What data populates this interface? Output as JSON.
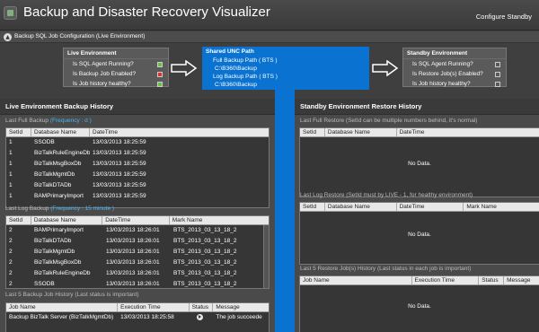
{
  "header": {
    "title": "Backup and Disaster Recovery Visualizer",
    "configure": "Configure Standby"
  },
  "subheader": {
    "label": "Backup SQL Job Configuration (Live Environment)"
  },
  "live_env": {
    "title": "Live Environment",
    "rows": [
      {
        "label": "Is SQL Agent Running?",
        "status": "ok"
      },
      {
        "label": "Is Backup Job Enabled?",
        "status": "bad"
      },
      {
        "label": "Is Job history healthy?",
        "status": "ok"
      }
    ]
  },
  "unc": {
    "title": "Shared UNC Path",
    "full_label": "Full Backup Path ( BTS )",
    "full_path": "C:\\B360\\Backup",
    "log_label": "Log Backup Path ( BTS )",
    "log_path": "C:\\B360\\Backup"
  },
  "standby_env": {
    "title": "Standby Environment",
    "rows": [
      {
        "label": "Is SQL Agent Running?",
        "status": "off"
      },
      {
        "label": "Is Restore Job(s) Enabled?",
        "status": "off"
      },
      {
        "label": "Is Job history healthy?",
        "status": "off"
      }
    ]
  },
  "live_history": {
    "title": "Live Environment Backup History",
    "full": {
      "label": "Last Full Backup",
      "freq": "(Frequency : d )",
      "columns": [
        "SetId",
        "Database Name",
        "DateTime"
      ],
      "rows": [
        [
          "1",
          "SSODB",
          "13/03/2013 18:25:59"
        ],
        [
          "1",
          "BizTalkRuleEngineDb",
          "13/03/2013 18:25:59"
        ],
        [
          "1",
          "BizTalkMsgBoxDb",
          "13/03/2013 18:25:59"
        ],
        [
          "1",
          "BizTalkMgmtDb",
          "13/03/2013 18:25:59"
        ],
        [
          "1",
          "BizTalkDTADb",
          "13/03/2013 18:25:59"
        ],
        [
          "1",
          "BAMPrimaryImport",
          "13/03/2013 18:25:59"
        ]
      ]
    },
    "log": {
      "label": "Last Log Backup",
      "freq": "(Frequency : 15 minute )",
      "columns": [
        "SetId",
        "Database Name",
        "DateTime",
        "Mark Name"
      ],
      "rows": [
        [
          "2",
          "BAMPrimaryImport",
          "13/03/2013 18:26:01",
          "BTS_2013_03_13_18_2"
        ],
        [
          "2",
          "BizTalkDTADb",
          "13/03/2013 18:26:01",
          "BTS_2013_03_13_18_2"
        ],
        [
          "2",
          "BizTalkMgmtDb",
          "13/03/2013 18:26:01",
          "BTS_2013_03_13_18_2"
        ],
        [
          "2",
          "BizTalkMsgBoxDb",
          "13/03/2013 18:26:01",
          "BTS_2013_03_13_18_2"
        ],
        [
          "2",
          "BizTalkRuleEngineDb",
          "13/03/2013 18:26:01",
          "BTS_2013_03_13_18_2"
        ],
        [
          "2",
          "SSODB",
          "13/03/2013 18:26:01",
          "BTS_2013_03_13_18_2"
        ]
      ]
    },
    "jobs": {
      "label": "Last 5 Backup Job History (Last status is important)",
      "columns": [
        "Job Name",
        "Execution Time",
        "Status",
        "Message"
      ],
      "rows": [
        [
          "Backup BizTalk Server (BizTalkMgmtDb)",
          "13/03/2013 18:25:58",
          "",
          "The job succeede"
        ]
      ]
    }
  },
  "standby_history": {
    "title": "Standby Environment Restore History",
    "full": {
      "label": "Last Full Restore (SetId can be multiple numbers behind, it's normal)",
      "columns": [
        "SetId",
        "Database Name",
        "DateTime"
      ],
      "nodata": "No Data."
    },
    "log": {
      "label": "Last Log Restore (SetId must by LIVE - 1, for healthy environment)",
      "columns": [
        "SetId",
        "Database Name",
        "DateTime",
        "Mark Name"
      ],
      "nodata": "No Data."
    },
    "jobs": {
      "label": "Last 5 Restore Job(s) History (Last status in each job is important)",
      "columns": [
        "Job Name",
        "Execution Time",
        "Status",
        "Message"
      ],
      "nodata": "No Data."
    }
  }
}
